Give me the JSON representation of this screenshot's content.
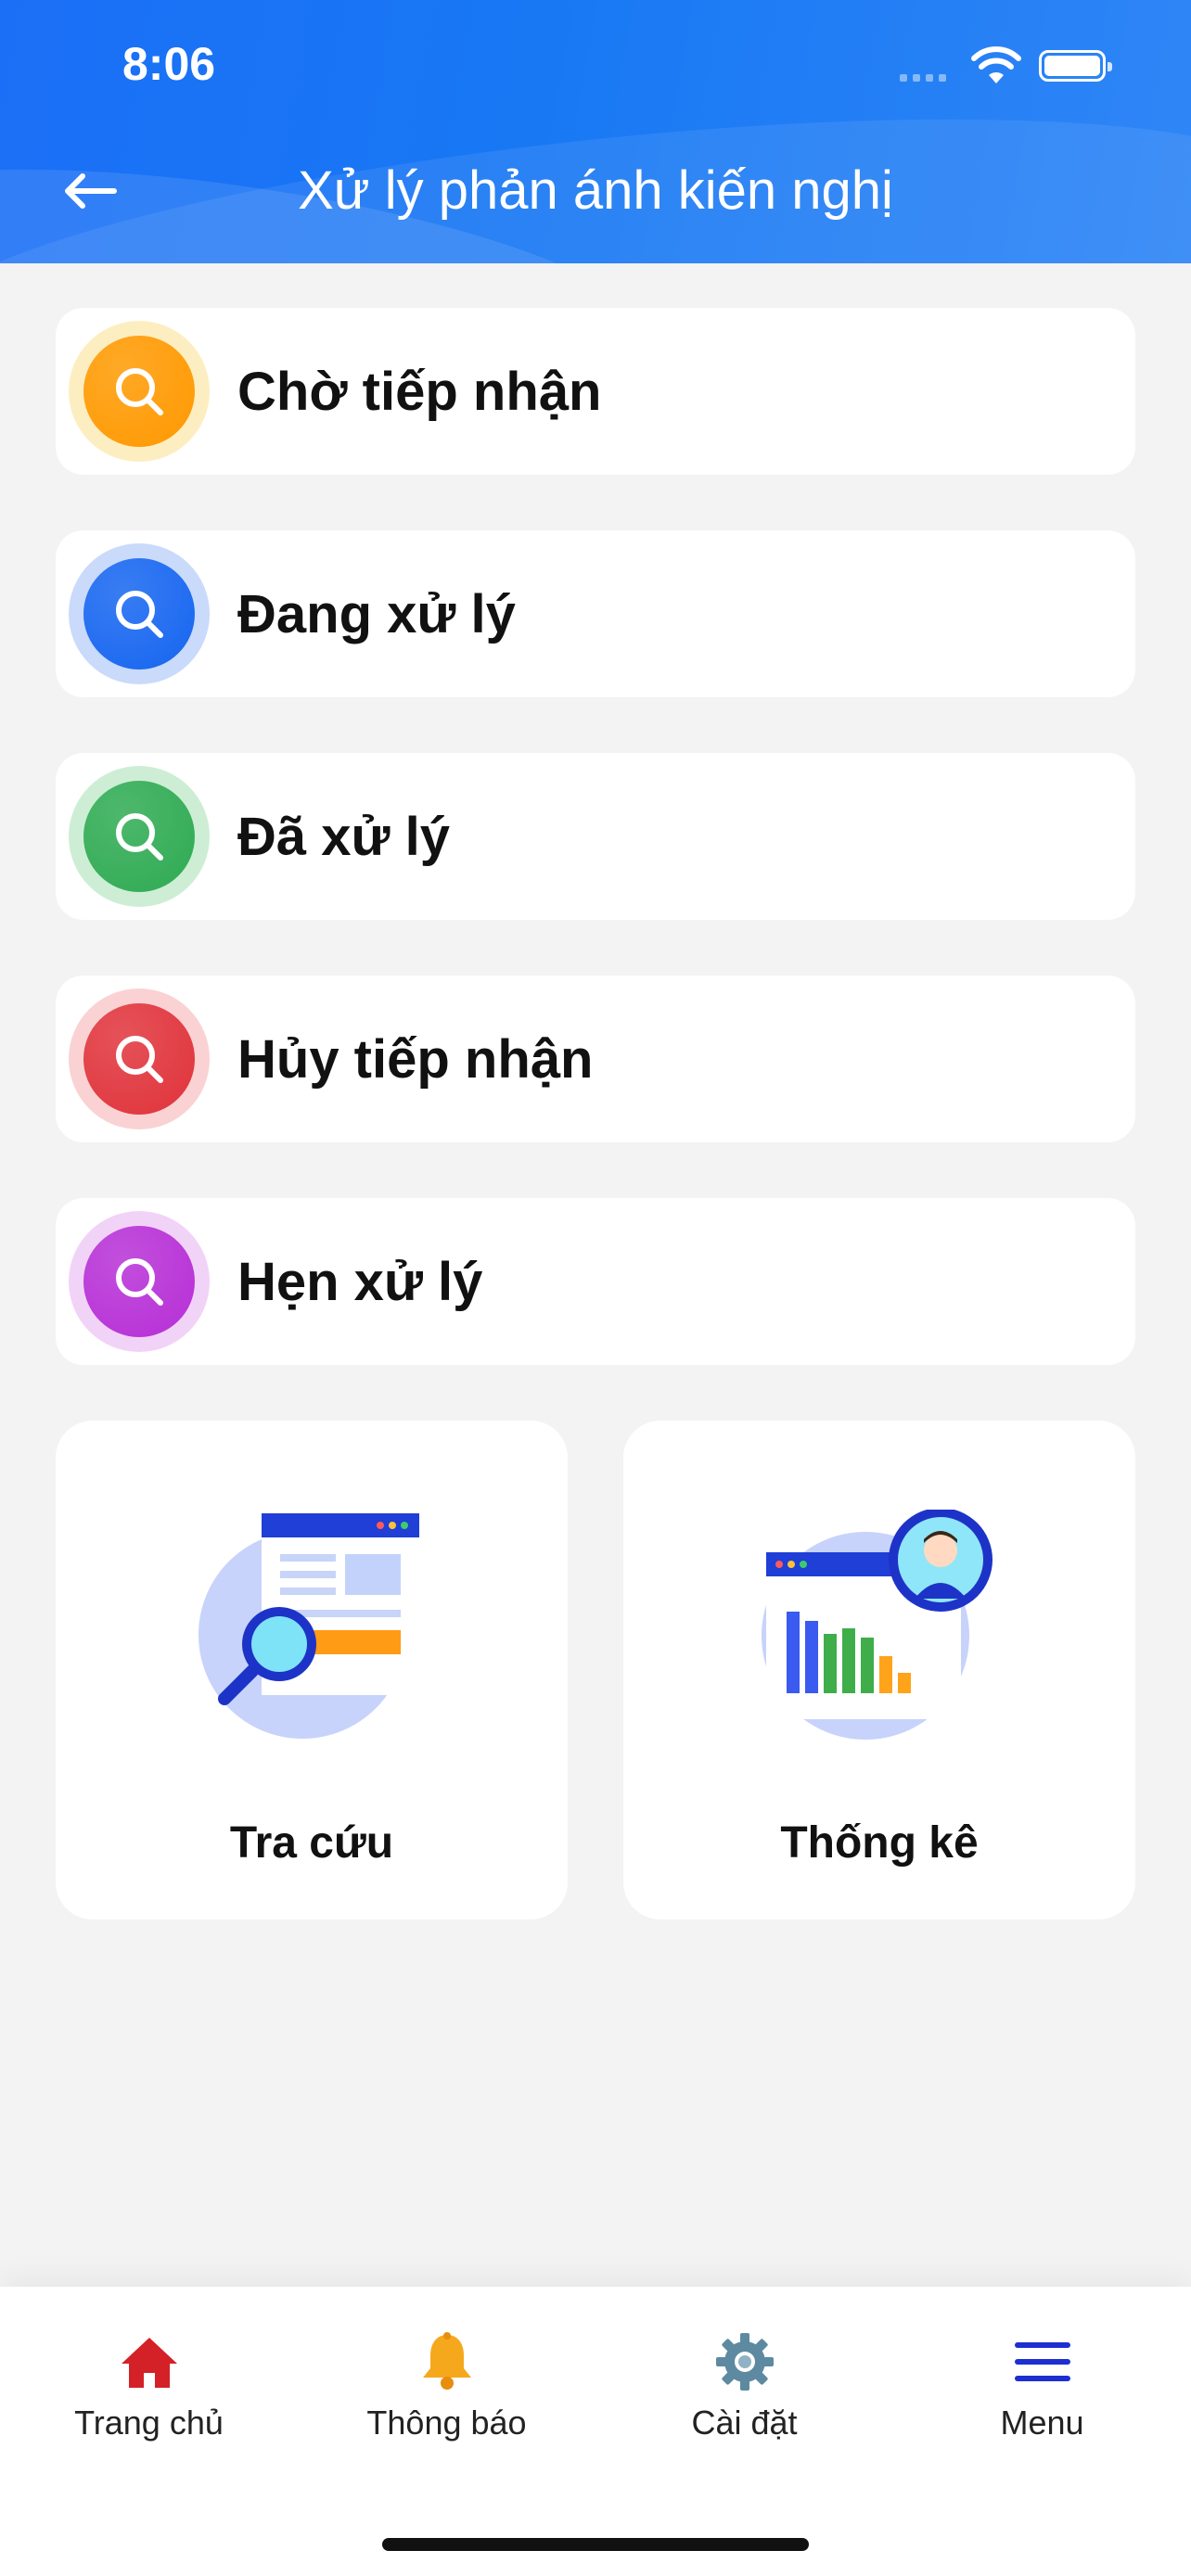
{
  "status_bar": {
    "time": "8:06"
  },
  "header": {
    "title": "Xử lý phản ánh kiến nghị",
    "back_icon": "arrow-left-icon",
    "color": "#1b6ff6"
  },
  "statuses": [
    {
      "label": "Chờ tiếp nhận",
      "icon": "search-icon",
      "color": "#ff9800",
      "halo": "#fdeec2"
    },
    {
      "label": "Đang xử lý",
      "icon": "search-icon",
      "color": "#1565f0",
      "halo": "#c9dafb"
    },
    {
      "label": "Đã xử lý",
      "icon": "search-icon",
      "color": "#2eaa52",
      "halo": "#cdeed4"
    },
    {
      "label": "Hủy tiếp nhận",
      "icon": "search-icon",
      "color": "#e0323a",
      "halo": "#fad2d3"
    },
    {
      "label": "Hẹn xử lý",
      "icon": "search-icon",
      "color": "#b62ed6",
      "halo": "#f2d3f8"
    }
  ],
  "tiles": [
    {
      "label": "Tra cứu",
      "icon": "document-search-illustration"
    },
    {
      "label": "Thống kê",
      "icon": "statistics-chart-illustration"
    }
  ],
  "bottom_nav": [
    {
      "label": "Trang chủ",
      "icon": "home-icon",
      "color": "#d42027"
    },
    {
      "label": "Thông báo",
      "icon": "bell-icon",
      "color": "#f6a81c"
    },
    {
      "label": "Cài đặt",
      "icon": "gear-icon",
      "color": "#5d8aa0"
    },
    {
      "label": "Menu",
      "icon": "menu-icon",
      "color": "#1e2fd1"
    }
  ]
}
